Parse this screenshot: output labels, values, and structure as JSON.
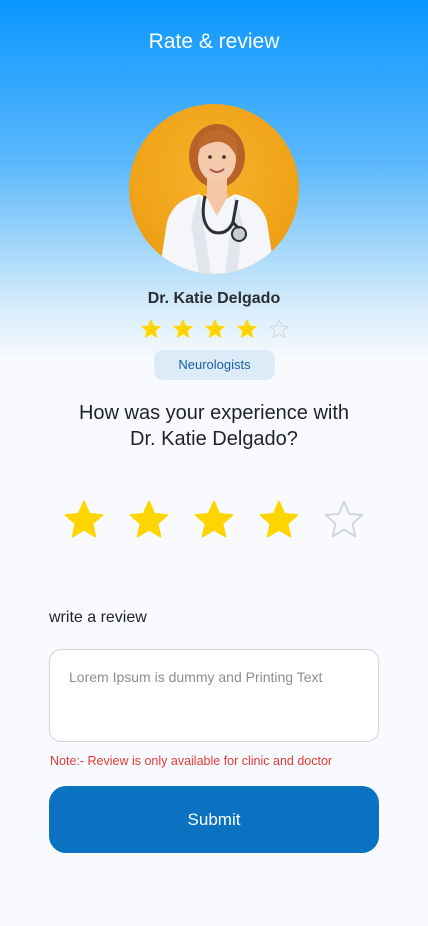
{
  "header": {
    "title": "Rate & review"
  },
  "doctor": {
    "name": "Dr. Katie Delgado",
    "rating": 4,
    "rating_max": 5,
    "specialty": "Neurologists"
  },
  "question": "How was your experience with Dr. Katie Delgado?",
  "user_rating": {
    "value": 4,
    "max": 5
  },
  "review": {
    "label": "write a review",
    "value": "",
    "placeholder": "Lorem Ipsum is dummy and Printing Text",
    "note": "Note:- Review is only available for clinic and doctor"
  },
  "submit_label": "Submit",
  "colors": {
    "accent": "#0b72c2",
    "star_filled": "#ffd500",
    "star_empty_stroke": "#cfd3d8",
    "note": "#e53935"
  }
}
